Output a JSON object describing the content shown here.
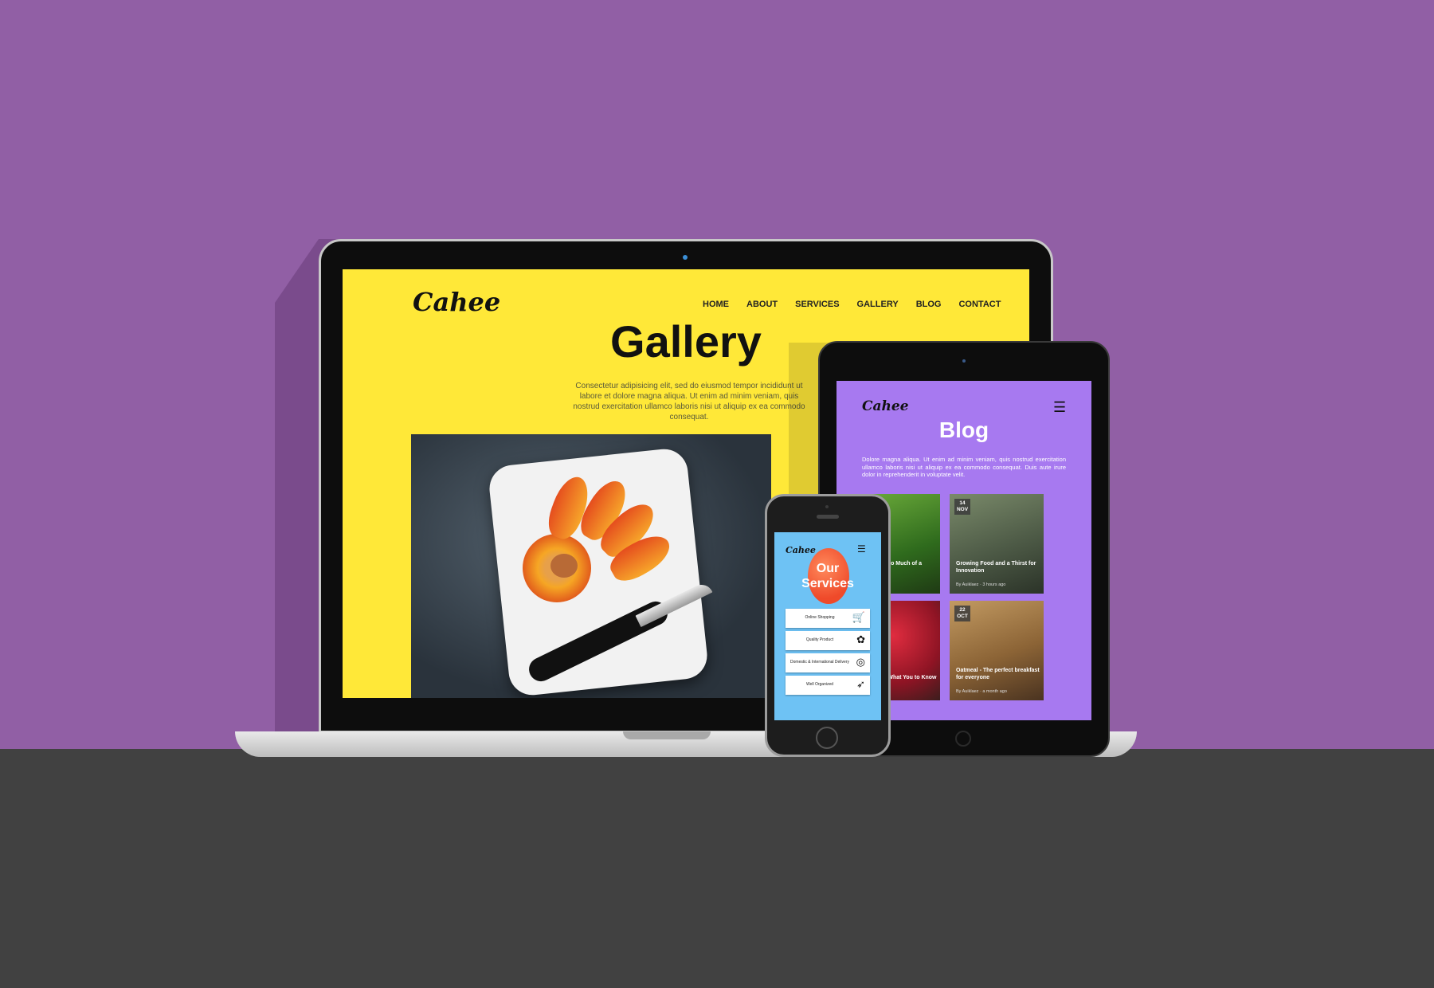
{
  "laptop_site": {
    "logo": "Cahee",
    "nav": [
      "HOME",
      "ABOUT",
      "SERVICES",
      "GALLERY",
      "BLOG",
      "CONTACT"
    ],
    "title": "Gallery",
    "description": "Consectetur adipisicing elit, sed do eiusmod tempor incididunt ut labore et dolore magna aliqua. Ut enim ad minim veniam, quis nostrud exercitation ullamco laboris nisi ut aliquip ex ea commodo consequat."
  },
  "tablet_site": {
    "logo": "Cahee",
    "title": "Blog",
    "description": "Dolore magna aliqua. Ut enim ad minim veniam, quis nostrud exercitation ullamco laboris nisi ut aliquip ex ea commodo consequat. Duis aute irure dolor in reprehenderit in voluptate velit.",
    "cards": [
      {
        "day": "",
        "month": "",
        "title": "Smoothies: Too Much of a Thing?",
        "meta": "aez · 2 hours ago"
      },
      {
        "day": "14",
        "month": "NOV",
        "title": "Growing Food and a Thirst for Innovation",
        "meta": "By Auiklaez · 3 hours ago"
      },
      {
        "day": "",
        "month": "",
        "title": "ides & Food: What You to Know",
        "meta": "aez · 6 hours ago"
      },
      {
        "day": "22",
        "month": "OCT",
        "title": "Oatmeal - The perfect breakfast for everyone",
        "meta": "By Auiklaez · a month ago"
      }
    ]
  },
  "phone_site": {
    "logo": "Cahee",
    "title_line1": "Our",
    "title_line2": "Services",
    "services": [
      {
        "label": "Online Shopping",
        "icon": "cart-icon"
      },
      {
        "label": "Quality Product",
        "icon": "plant-icon"
      },
      {
        "label": "Domestic & International Delivery",
        "icon": "delivery-icon"
      },
      {
        "label": "Well Organized",
        "icon": "carrot-icon"
      }
    ]
  },
  "colors": {
    "background_purple": "#915fa5",
    "floor_gray": "#414141",
    "laptop_screen_yellow": "#ffe838",
    "tablet_screen_purple": "#a779f0",
    "phone_screen_blue": "#6ec2f4"
  }
}
